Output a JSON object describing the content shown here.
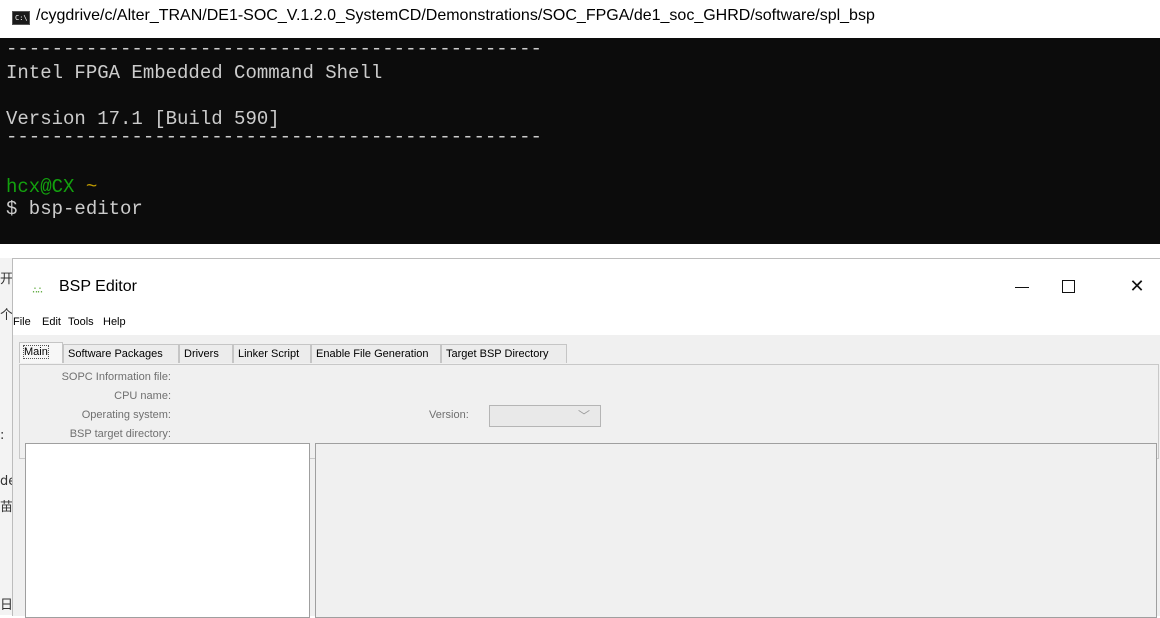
{
  "console": {
    "title": "/cygdrive/c/Alter_TRAN/DE1-SOC_V.1.2.0_SystemCD/Demonstrations/SOC_FPGA/de1_soc_GHRD/software/spl_bsp",
    "icon": "cmd-icon",
    "icon_text": "C:\\",
    "divider": "-----------------------------------------------",
    "shell_name": "Intel FPGA Embedded Command Shell",
    "version_line": "Version 17.1 [Build 590]",
    "prompt_user": "hcx@CX",
    "prompt_dir": "~",
    "command": "$ bsp-editor"
  },
  "behind": {
    "glyphs": [
      "开",
      "个",
      ":",
      "de",
      "苗",
      "日"
    ]
  },
  "bsp_editor": {
    "title": "BSP Editor",
    "icon": "bsp-editor-icon",
    "icon_text": "∴∴",
    "window_controls": {
      "minimize": "—",
      "maximize": "☐",
      "close": "✕"
    },
    "menu": [
      "File",
      "Edit",
      "Tools",
      "Help"
    ],
    "tabs": [
      "Main",
      "Software Packages",
      "Drivers",
      "Linker Script",
      "Enable File Generation",
      "Target BSP Directory"
    ],
    "active_tab": "Main",
    "fields": {
      "sopc_label": "SOPC Information file:",
      "cpu_label": "CPU name:",
      "os_label": "Operating system:",
      "bsp_dir_label": "BSP target directory:",
      "version_label": "Version:",
      "version_value": ""
    }
  }
}
